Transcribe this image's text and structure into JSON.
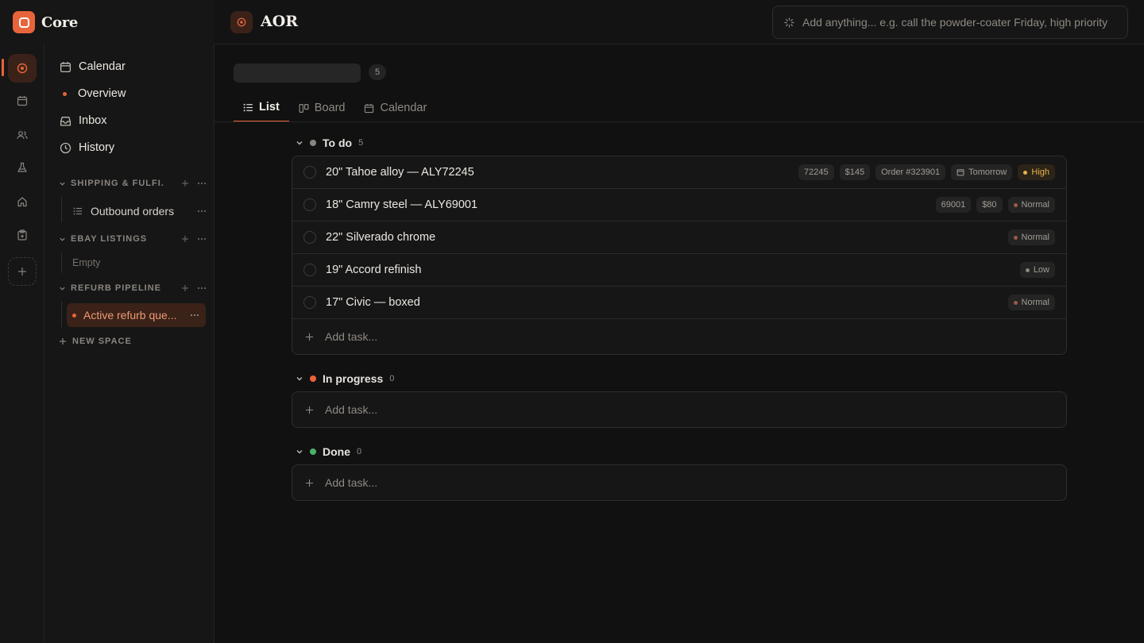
{
  "app": {
    "name": "Core",
    "logo_icon": "core-logo-icon",
    "accent": "#e8643a"
  },
  "rail": {
    "items": [
      {
        "icon": "target-icon",
        "active": true
      },
      {
        "icon": "calendar-icon"
      },
      {
        "icon": "users-icon"
      },
      {
        "icon": "flask-icon"
      },
      {
        "icon": "home-icon"
      },
      {
        "icon": "clipboard-icon"
      },
      {
        "icon": "plus-icon"
      }
    ]
  },
  "nav": {
    "calendar": "Calendar",
    "overview": "Overview",
    "inbox": "Inbox",
    "history": "History",
    "new_space": "NEW SPACE",
    "sections": [
      {
        "label": "SHIPPING & FULFILLMENT",
        "label_display": "SHIPPING & FULFI...",
        "items": [
          {
            "label": "Outbound orders",
            "icon": "list-icon"
          }
        ]
      },
      {
        "label": "EBAY LISTINGS",
        "label_display": "EBAY LISTINGS",
        "items": [],
        "empty": "Empty"
      },
      {
        "label": "REFURB PIPELINE",
        "label_display": "REFURB PIPELINE",
        "items": [
          {
            "label": "Active refurb que...",
            "active": true
          }
        ]
      }
    ]
  },
  "header": {
    "title": "AOR",
    "icon": "target-icon",
    "quick_add_placeholder": "Add anything...  e.g. call the powder-coater Friday, high priority"
  },
  "filter": {
    "count": "5"
  },
  "tabs": [
    {
      "label": "List",
      "icon": "list-icon",
      "active": true
    },
    {
      "label": "Board",
      "icon": "board-icon"
    },
    {
      "label": "Calendar",
      "icon": "calendar-icon"
    }
  ],
  "groups": [
    {
      "name": "To do",
      "count": "5",
      "color": "#8a8580",
      "tasks": [
        {
          "title": "20\" Tahoe alloy — ALY72245",
          "chips": [
            "72245",
            "$145",
            "Order #323901"
          ],
          "due": "Tomorrow",
          "priority": "High",
          "priority_color": "#e8b04a"
        },
        {
          "title": "18\" Camry steel — ALY69001",
          "chips": [
            "69001",
            "$80"
          ],
          "priority": "Normal",
          "priority_color": "#9a5a45"
        },
        {
          "title": "22\" Silverado chrome",
          "chips": [],
          "priority": "Normal",
          "priority_color": "#9a5a45"
        },
        {
          "title": "19\" Accord refinish",
          "chips": [],
          "priority": "Low",
          "priority_color": "#8a8580"
        },
        {
          "title": "17\" Civic — boxed",
          "chips": [],
          "priority": "Normal",
          "priority_color": "#9a5a45"
        }
      ],
      "add_label": "Add task..."
    },
    {
      "name": "In progress",
      "count": "0",
      "color": "#e8643a",
      "tasks": [],
      "add_label": "Add task..."
    },
    {
      "name": "Done",
      "count": "0",
      "color": "#4caf6a",
      "tasks": [],
      "add_label": "Add task..."
    }
  ]
}
